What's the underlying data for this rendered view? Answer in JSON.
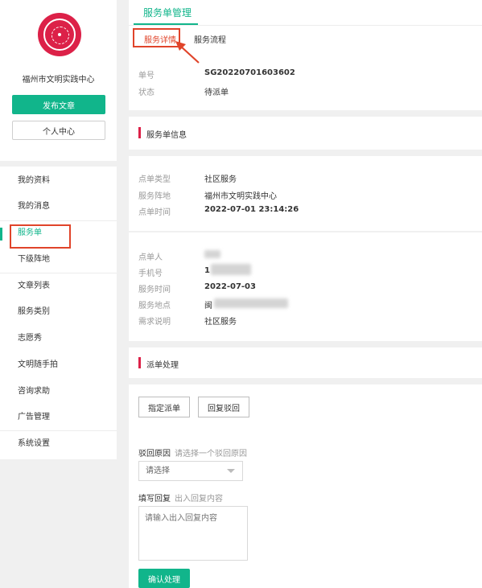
{
  "sidebar": {
    "org_name": "福州市文明实践中心",
    "publish_button": "发布文章",
    "personal_center_button": "个人中心",
    "menu": [
      {
        "label": "我的资料"
      },
      {
        "label": "我的消息"
      },
      {
        "label": "服务单",
        "active": true
      },
      {
        "label": "下级阵地"
      },
      {
        "label": "文章列表"
      },
      {
        "label": "服务类别"
      },
      {
        "label": "志愿秀"
      },
      {
        "label": "文明随手拍"
      },
      {
        "label": "咨询求助"
      },
      {
        "label": "广告管理"
      },
      {
        "label": "系统设置"
      }
    ]
  },
  "page": {
    "title": "服务单管理",
    "tabs": [
      {
        "label": "服务详情",
        "active": true
      },
      {
        "label": "服务流程"
      }
    ]
  },
  "summary": {
    "order_no_label": "单号",
    "order_no": "SG20220701603602",
    "status_label": "状态",
    "status": "待派单"
  },
  "order_info": {
    "section_title": "服务单信息",
    "type_label": "点单类型",
    "type": "社区服务",
    "position_label": "服务阵地",
    "position": "福州市文明实践中心",
    "time_label": "点单时间",
    "time": "2022-07-01 23:14:26"
  },
  "requester": {
    "person_label": "点单人",
    "phone_label": "手机号",
    "phone_visible": "1",
    "service_time_label": "服务时间",
    "service_time": "2022-07-03",
    "location_label": "服务地点",
    "location_visible": "闽",
    "need_label": "需求说明",
    "need": "社区服务"
  },
  "dispatch": {
    "section_title": "派单处理",
    "assign_button": "指定派单",
    "reject_button": "回复驳回",
    "reject_reason_label": "驳回原因",
    "reject_reason_hint": "请选择一个驳回原因",
    "select_placeholder": "请选择",
    "reply_label": "填写回复",
    "reply_hint": "出入回复内容",
    "textarea_placeholder": "请输入出入回复内容",
    "confirm_button": "确认处理"
  },
  "colors": {
    "accent": "#11b58b",
    "section_bar": "#dc2148",
    "highlight": "#e0442a"
  }
}
